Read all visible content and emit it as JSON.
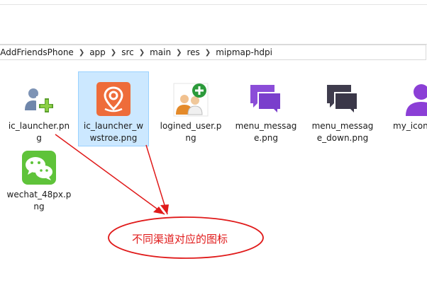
{
  "breadcrumb": [
    "sAddFriendsPhone",
    "app",
    "src",
    "main",
    "res",
    "mipmap-hdpi"
  ],
  "files": [
    {
      "name": "ic_launcher.png",
      "icon": "add-friend-icon"
    },
    {
      "name": "ic_launcher_wwstroe.png",
      "icon": "location-pin-icon"
    },
    {
      "name": "logined_user.png",
      "icon": "users-add-icon"
    },
    {
      "name": "menu_message.png",
      "icon": "message-bubbles-purple-icon"
    },
    {
      "name": "menu_message_down.png",
      "icon": "message-bubbles-dark-icon"
    },
    {
      "name": "my_icon.png",
      "icon": "person-purple-icon"
    },
    {
      "name": "wechat_48px.png",
      "icon": "wechat-icon"
    }
  ],
  "annotation": {
    "text": "不同渠道对应的图标",
    "color": "#e01a1a"
  },
  "colors": {
    "selection": "#cce8ff",
    "selection_border": "#99d1ff",
    "annotation": "#e01a1a"
  }
}
